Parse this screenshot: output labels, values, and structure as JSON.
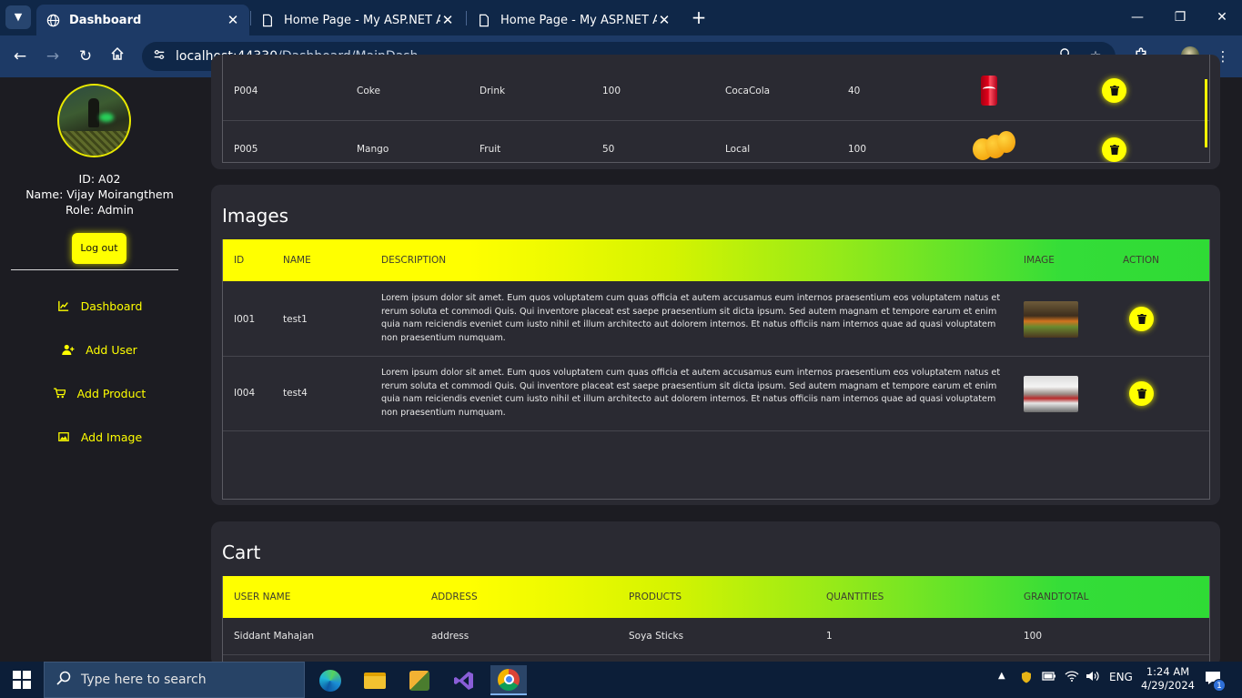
{
  "browser": {
    "tabs": [
      {
        "title": "Dashboard",
        "active": true,
        "close": "✕"
      },
      {
        "title": "Home Page - My ASP.NET App",
        "active": false,
        "close": "✕"
      },
      {
        "title": "Home Page - My ASP.NET App",
        "active": false,
        "close": "✕"
      }
    ],
    "new_tab": "+",
    "url_host": "localhost:44330",
    "url_path": "/Dashboard/MainDash"
  },
  "sidebar": {
    "user_id": "ID: A02",
    "user_name": "Name: Vijay Moirangthem",
    "user_role": "Role: Admin",
    "logout_label": "Log out",
    "menu": [
      {
        "label": "Dashboard",
        "icon": "chart-icon"
      },
      {
        "label": "Add User",
        "icon": "user-plus-icon"
      },
      {
        "label": "Add Product",
        "icon": "cart-plus-icon"
      },
      {
        "label": "Add Image",
        "icon": "image-icon"
      }
    ]
  },
  "products": {
    "rows": [
      {
        "id": "P004",
        "name": "Coke",
        "category": "Drink",
        "price": "100",
        "brand": "CocaCola",
        "stock": "40",
        "image": "coke-can"
      },
      {
        "id": "P005",
        "name": "Mango",
        "category": "Fruit",
        "price": "50",
        "brand": "Local",
        "stock": "100",
        "image": "mangoes"
      }
    ]
  },
  "images": {
    "title": "Images",
    "columns": {
      "id": "ID",
      "name": "NAME",
      "description": "DESCRIPTION",
      "image": "IMAGE",
      "action": "ACTION"
    },
    "rows": [
      {
        "id": "I001",
        "name": "test1",
        "description": "Lorem ipsum dolor sit amet. Eum quos voluptatem cum quas officia et autem accusamus eum internos praesentium eos voluptatem natus et rerum soluta et commodi Quis. Qui inventore placeat est saepe praesentium sit dicta ipsum. Sed autem magnam et tempore earum et enim quia nam reiciendis eveniet cum iusto nihil et illum architecto aut dolorem internos. Et natus officiis nam internos quae ad quasi voluptatem non praesentium numquam."
      },
      {
        "id": "I004",
        "name": "test4",
        "description": "Lorem ipsum dolor sit amet. Eum quos voluptatem cum quas officia et autem accusamus eum internos praesentium eos voluptatem natus et rerum soluta et commodi Quis. Qui inventore placeat est saepe praesentium sit dicta ipsum. Sed autem magnam et tempore earum et enim quia nam reiciendis eveniet cum iusto nihil et illum architecto aut dolorem internos. Et natus officiis nam internos quae ad quasi voluptatem non praesentium numquam."
      }
    ]
  },
  "cart": {
    "title": "Cart",
    "columns": {
      "user_name": "USER NAME",
      "address": "ADDRESS",
      "products": "PRODUCTS",
      "quantities": "QUANTITIES",
      "grandtotal": "GRANDTOTAL"
    },
    "rows": [
      {
        "user_name": "Siddant Mahajan",
        "address": "address",
        "products": "Soya Sticks",
        "quantities": "1",
        "grandtotal": "100"
      }
    ]
  },
  "taskbar": {
    "search_placeholder": "Type here to search",
    "language": "ENG",
    "time": "1:24 AM",
    "date": "4/29/2024",
    "notification_count": "1"
  },
  "colors": {
    "accent": "#ffff00",
    "header_gradient_end": "#2fdb35",
    "panel_bg": "#2a2a32",
    "page_bg": "#1c1c22",
    "browser_chrome": "#1d3a66"
  }
}
